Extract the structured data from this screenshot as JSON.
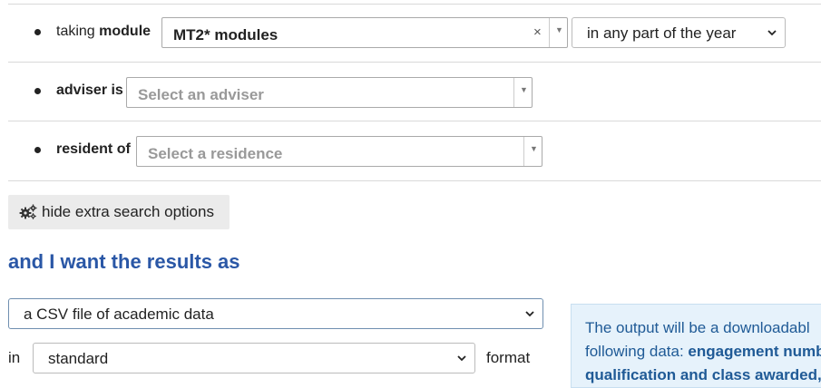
{
  "criteria": {
    "module": {
      "prefix": "taking",
      "bold": "module",
      "value": "MT2* modules",
      "clear_glyph": "×",
      "period": "in any part of the year"
    },
    "adviser": {
      "bold": "adviser is",
      "placeholder": "Select an adviser"
    },
    "residence": {
      "bold": "resident of",
      "placeholder": "Select a residence"
    }
  },
  "options_button": {
    "label": "hide extra search options",
    "icon": "gears-icon"
  },
  "results": {
    "heading": "and I want the results as",
    "output_type": "a CSV file of academic data",
    "in_label": "in",
    "format_value": "standard",
    "format_label": "format"
  },
  "info": {
    "line1": "The output will be a downloadabl",
    "line2_text": "following data: ",
    "line2_bold": "engagement numb",
    "line3": "qualification and class awarded, ye"
  },
  "colors": {
    "heading": "#2a57a6",
    "info_bg": "#e6f2fb",
    "info_text": "#1f5a96"
  }
}
